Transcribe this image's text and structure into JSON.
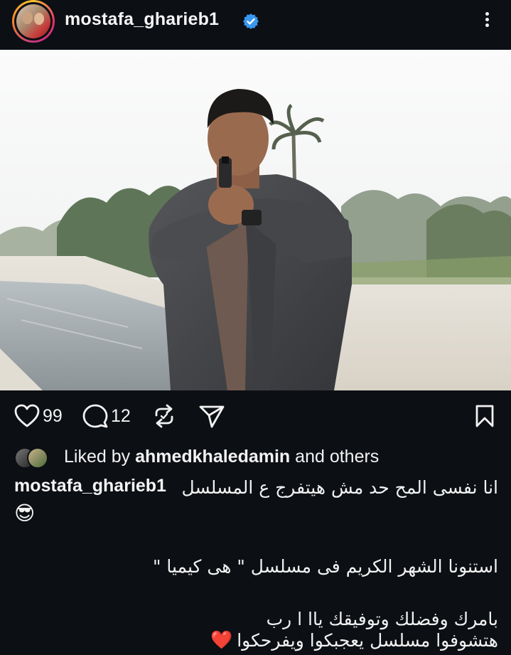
{
  "header": {
    "username": "mostafa_gharieb1",
    "verified": true,
    "more_icon": "more-vertical-icon"
  },
  "photo": {
    "icon": "post-photo"
  },
  "actions": {
    "likes": "99",
    "comments": "12",
    "like_icon": "heart-icon",
    "comment_icon": "comment-icon",
    "repost_icon": "repost-icon",
    "share_icon": "send-icon",
    "save_icon": "bookmark-icon"
  },
  "liked_by": {
    "prefix": "Liked by",
    "user": "ahmedkhaledamin",
    "suffix": "and others"
  },
  "caption": {
    "username": "mostafa_gharieb1",
    "line1": "انا نفسى المح حد مش هيتفرج ع المسلسل",
    "line2": "استنونا الشهر الكريم فى مسلسل \" هى كيميا \"",
    "line3": "بامرك وفضلك وتوفيقك ياا ا رب",
    "line4": "هتشوفوا مسلسل يعجبكوا ويفرحكوا",
    "emoji1": "😎",
    "emoji2": "❤️"
  },
  "colors": {
    "background": "#0c0f14",
    "text": "#f2f2f2",
    "verified": "#3897f0",
    "heart": "#e0202e"
  }
}
